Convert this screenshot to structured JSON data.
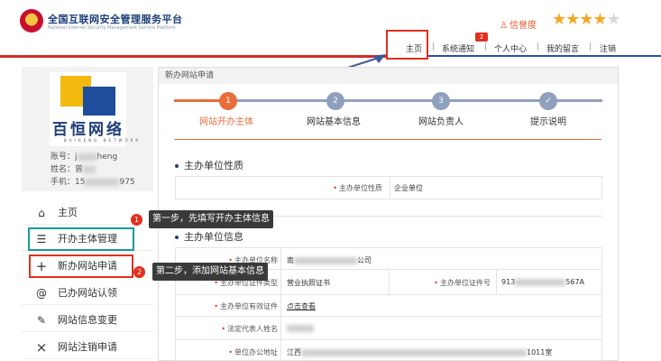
{
  "header": {
    "site_title": "全国互联网安全管理服务平台",
    "site_subtitle": "National Internet Security Management Service Platform",
    "credit_label": "信誉度",
    "stars": {
      "filled": 4,
      "total": 5
    },
    "nav": [
      {
        "label": "主页",
        "badge": ""
      },
      {
        "label": "系统通知",
        "badge": "2"
      },
      {
        "label": "个人中心",
        "badge": ""
      },
      {
        "label": "我的留言",
        "badge": ""
      },
      {
        "label": "注销",
        "badge": ""
      }
    ]
  },
  "profile": {
    "logo_text": "百恒网络",
    "logo_sub": "BAIHENG NETWORK",
    "account_label": "账号：",
    "account_visible": "j",
    "account_tail": "heng",
    "name_label": "姓名：",
    "name_visible": "曾",
    "phone_label": "手机：",
    "phone_visible": "15",
    "phone_tail": "975"
  },
  "menu": [
    {
      "label": "主页",
      "icon": "home-icon",
      "glyph": "⌂"
    },
    {
      "label": "开办主体管理",
      "icon": "list-icon",
      "glyph": "☰"
    },
    {
      "label": "新办网站申请",
      "icon": "plus-icon",
      "glyph": "+"
    },
    {
      "label": "已办网站认领",
      "icon": "at-icon",
      "glyph": "@"
    },
    {
      "label": "网站信息变更",
      "icon": "edit-icon",
      "glyph": "✎"
    },
    {
      "label": "网站注销申请",
      "icon": "close-icon",
      "glyph": "×"
    }
  ],
  "tips": [
    {
      "num": "1",
      "text": "第一步，先填写开办主体信息"
    },
    {
      "num": "2",
      "text": "第二步，添加网站基本信息"
    }
  ],
  "main": {
    "panel_title": "新办网站申请",
    "steps": [
      {
        "num": "1",
        "label": "网站开办主体",
        "state": "active"
      },
      {
        "num": "2",
        "label": "网站基本信息",
        "state": "pending"
      },
      {
        "num": "3",
        "label": "网站负责人",
        "state": "pending"
      },
      {
        "num": "✓",
        "label": "提示说明",
        "state": "pending"
      }
    ],
    "section1_title": "主办单位性质",
    "org_nature_label": "主办单位性质",
    "org_nature_value": "企业单位",
    "section2_title": "主办单位信息",
    "fields": {
      "org_name_label": "主办单位名称",
      "org_name_value": "南",
      "org_name_tail": "公司",
      "cert_type_label": "主办单位证件类型",
      "cert_type_value": "营业执照证书",
      "cert_no_label": "主办单位证件号",
      "cert_no_value": "913",
      "cert_no_tail": "567A",
      "valid_cert_label": "主办单位有效证件",
      "valid_cert_value": "点击查看",
      "legal_rep_label": "法定代表人姓名",
      "address_label": "单位办公地址",
      "address_value": "江西",
      "address_tail": "1011室"
    }
  },
  "colors": {
    "accent_orange": "#e86d3a",
    "step_pending": "#8fa0bd",
    "alert_red": "#e0301e",
    "teal": "#16999b"
  }
}
